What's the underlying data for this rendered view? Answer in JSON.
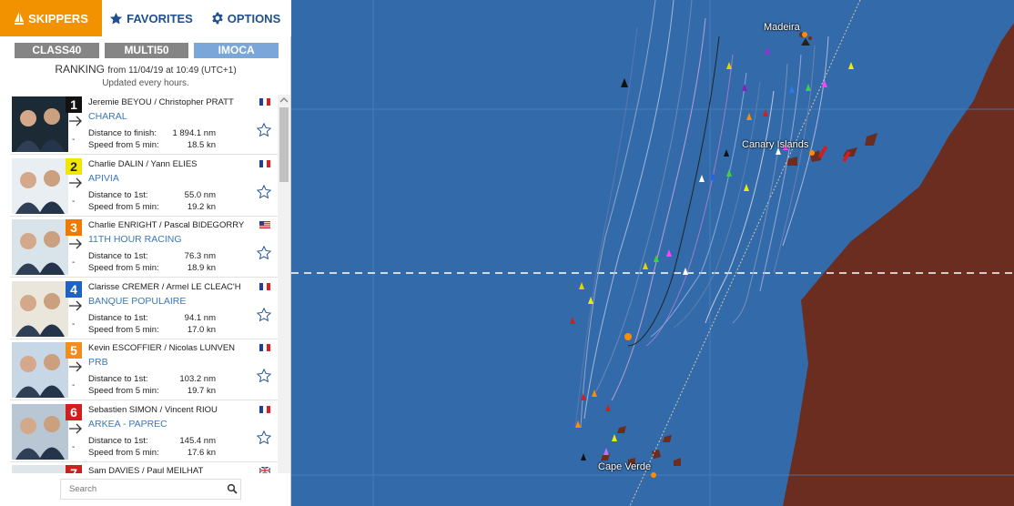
{
  "tabs": [
    {
      "label": "SKIPPERS",
      "icon": "sail-icon",
      "active": true
    },
    {
      "label": "FAVORITES",
      "icon": "star-icon",
      "active": false
    },
    {
      "label": "OPTIONS",
      "icon": "gear-icon",
      "active": false
    }
  ],
  "classes": [
    {
      "label": "CLASS40",
      "active": false
    },
    {
      "label": "MULTI50",
      "active": false
    },
    {
      "label": "IMOCA",
      "active": true
    }
  ],
  "ranking": {
    "title": "RANKING",
    "from": "from 11/04/19 at 10:49 (UTC+1)",
    "updated": "Updated every hours."
  },
  "entries": [
    {
      "rank": "1",
      "rank_color": "#111111",
      "skippers": "Jeremie BEYOU / Christopher PRATT",
      "boat": "CHARAL",
      "flag": "france-flag",
      "dist_label": "Distance to finish:",
      "dist": "1 894.1 nm",
      "speed_label": "Speed from 5 min:",
      "speed": "18.5 kn",
      "trend": "-"
    },
    {
      "rank": "2",
      "rank_color": "#f0e600",
      "skippers": "Charlie DALIN / Yann ELIES",
      "boat": "APIVIA",
      "flag": "france-flag",
      "dist_label": "Distance to 1st:",
      "dist": "55.0 nm",
      "speed_label": "Speed from 5 min:",
      "speed": "19.2 kn",
      "trend": "-"
    },
    {
      "rank": "3",
      "rank_color": "#f07a00",
      "skippers": "Charlie ENRIGHT / Pascal BIDEGORRY",
      "boat": "11TH HOUR RACING",
      "flag": "usa-flag",
      "dist_label": "Distance to 1st:",
      "dist": "76.3 nm",
      "speed_label": "Speed from 5 min:",
      "speed": "18.9 kn",
      "trend": "-"
    },
    {
      "rank": "4",
      "rank_color": "#1e63c4",
      "skippers": "Clarisse CREMER / Armel LE CLEAC'H",
      "boat": "BANQUE POPULAIRE",
      "flag": "france-flag",
      "dist_label": "Distance to 1st:",
      "dist": "94.1 nm",
      "speed_label": "Speed from 5 min:",
      "speed": "17.0 kn",
      "trend": "-"
    },
    {
      "rank": "5",
      "rank_color": "#f28c1c",
      "skippers": "Kevin ESCOFFIER / Nicolas LUNVEN",
      "boat": "PRB",
      "flag": "france-flag",
      "dist_label": "Distance to 1st:",
      "dist": "103.2 nm",
      "speed_label": "Speed from 5 min:",
      "speed": "19.7 kn",
      "trend": "-"
    },
    {
      "rank": "6",
      "rank_color": "#d01f1f",
      "skippers": "Sebastien SIMON / Vincent RIOU",
      "boat": "ARKEA - PAPREC",
      "flag": "france-flag",
      "dist_label": "Distance to 1st:",
      "dist": "145.4 nm",
      "speed_label": "Speed from 5 min:",
      "speed": "17.6 kn",
      "trend": "-"
    },
    {
      "rank": "7",
      "rank_color": "#d01f1f",
      "skippers": "Sam DAVIES / Paul MEILHAT",
      "boat": "",
      "flag": "uk-flag",
      "dist_label": "",
      "dist": "",
      "speed_label": "",
      "speed": "",
      "trend": ""
    }
  ],
  "search": {
    "placeholder": "Search"
  },
  "map": {
    "labels": [
      "Madeira",
      "Canary Islands",
      "Cape Verde"
    ],
    "ocean_color": "#336baa",
    "land_color": "#6b2d1f"
  }
}
